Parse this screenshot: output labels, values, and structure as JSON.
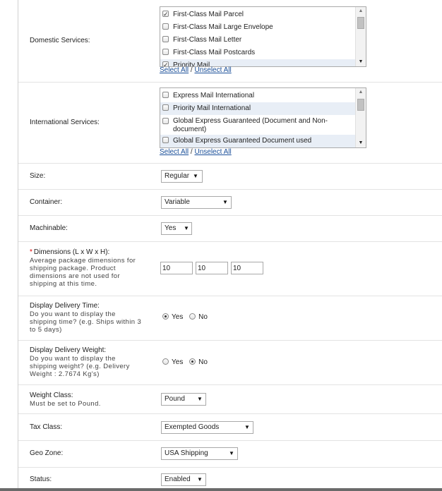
{
  "domestic": {
    "label": "Domestic Services:",
    "options": [
      {
        "label": "First-Class Mail Parcel",
        "checked": true,
        "selected": false
      },
      {
        "label": "First-Class Mail Large Envelope",
        "checked": false,
        "selected": false
      },
      {
        "label": "First-Class Mail Letter",
        "checked": false,
        "selected": false
      },
      {
        "label": "First-Class Mail Postcards",
        "checked": false,
        "selected": false
      },
      {
        "label": "Priority Mail",
        "checked": true,
        "selected": true
      }
    ],
    "select_all": "Select All",
    "separator": " / ",
    "unselect_all": "Unselect All"
  },
  "international": {
    "label": "International Services:",
    "options": [
      {
        "label": "Express Mail International",
        "checked": false,
        "selected": false
      },
      {
        "label": "Priority Mail International",
        "checked": false,
        "selected": true
      },
      {
        "label": "Global Express Guaranteed (Document and Non-document)",
        "checked": false,
        "selected": false
      },
      {
        "label": "Global Express Guaranteed Document used",
        "checked": false,
        "selected": true
      }
    ],
    "select_all": "Select All",
    "separator": " / ",
    "unselect_all": "Unselect All"
  },
  "size": {
    "label": "Size:",
    "value": "Regular"
  },
  "container": {
    "label": "Container:",
    "value": "Variable"
  },
  "machinable": {
    "label": "Machinable:",
    "value": "Yes"
  },
  "dimensions": {
    "required_mark": "*",
    "label": "Dimensions (L x W x H):",
    "help": "Average package dimensions for shipping package. Product dimensions are not used for shipping at this time.",
    "length": "10",
    "width": "10",
    "height": "10"
  },
  "display_time": {
    "label": "Display Delivery Time:",
    "help": "Do you want to display the shipping time? (e.g. Ships within 3 to 5 days)",
    "yes_label": "Yes",
    "no_label": "No",
    "selected": "Yes"
  },
  "display_weight": {
    "label": "Display Delivery Weight:",
    "help": "Do you want to display the shipping weight? (e.g. Delivery Weight : 2.7674 Kg's)",
    "yes_label": "Yes",
    "no_label": "No",
    "selected": "No"
  },
  "weight_class": {
    "label": "Weight Class:",
    "help": "Must be set to Pound.",
    "value": "Pound"
  },
  "tax_class": {
    "label": "Tax Class:",
    "value": "Exempted Goods"
  },
  "geo_zone": {
    "label": "Geo Zone:",
    "value": "USA Shipping"
  },
  "status": {
    "label": "Status:",
    "value": "Enabled"
  },
  "icons": {
    "checkbox_checked": "checkmark-icon",
    "dropdown": "triangle-down-icon",
    "scroll_up": "triangle-up-icon",
    "scroll_down": "triangle-down-icon"
  },
  "colors": {
    "link": "#1a4f99",
    "selected_row": "#e8eef6",
    "required": "#dd0000",
    "row_divider": "#e3e3e3"
  }
}
